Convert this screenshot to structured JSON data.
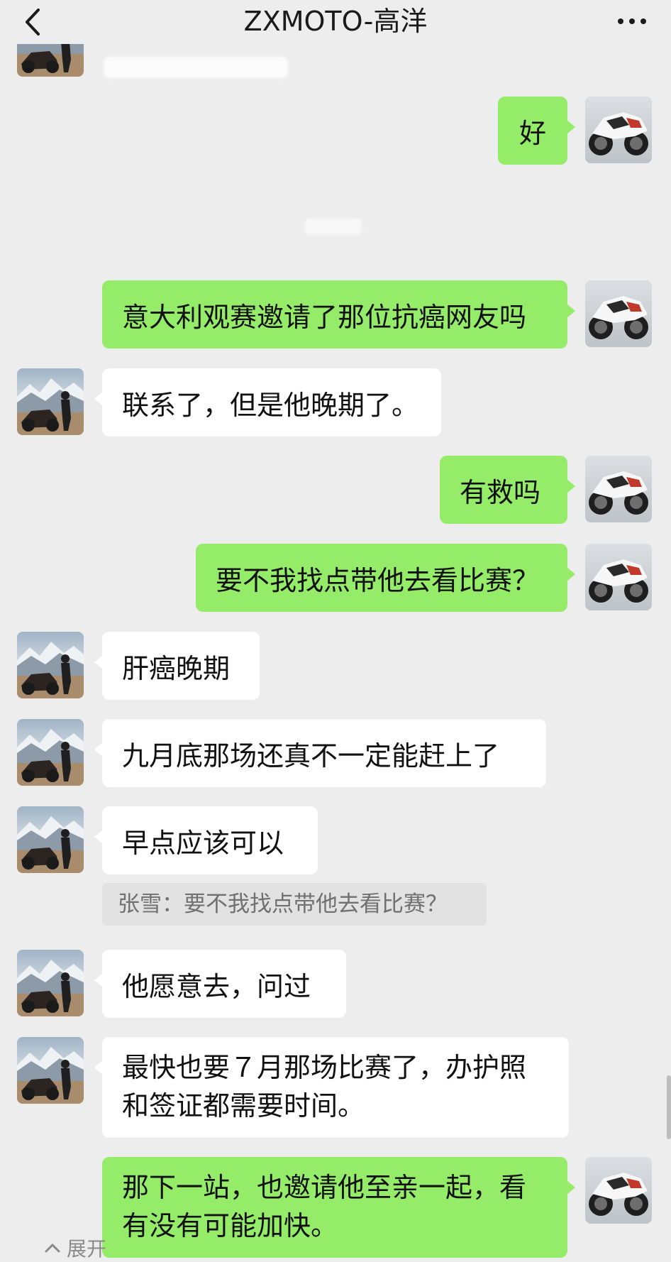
{
  "header": {
    "title": "ZXMOTO-高洋",
    "back_icon": "chevron-left-icon",
    "more_icon": "more-dots-icon"
  },
  "messages": [
    {
      "side": "self",
      "text": "好"
    },
    {
      "side": "self",
      "text": "意大利观赛邀请了那位抗癌网友吗"
    },
    {
      "side": "peer",
      "text": "联系了，但是他晚期了。"
    },
    {
      "side": "self",
      "text": "有救吗"
    },
    {
      "side": "self",
      "text": "要不我找点带他去看比赛？"
    },
    {
      "side": "peer",
      "text": "肝癌晚期"
    },
    {
      "side": "peer",
      "text": "九月底那场还真不一定能赶上了"
    },
    {
      "side": "peer",
      "text": "早点应该可以"
    },
    {
      "side": "peer",
      "text": "他愿意去，问过"
    },
    {
      "side": "peer",
      "lines": [
        "最快也要７月那场比赛了，办护照",
        "和签证都需要时间。"
      ]
    },
    {
      "side": "self",
      "lines": [
        "那下一站，也邀请他至亲一起，看",
        "有没有可能加快。"
      ]
    }
  ],
  "quote": {
    "text": "张雪：要不我找点带他去看比赛？"
  },
  "footer": {
    "expand_label": "展开",
    "expand_icon": "chevron-up-icon"
  },
  "colors": {
    "background": "#ededed",
    "self_bubble": "#95ec69",
    "peer_bubble": "#ffffff",
    "quote_bg": "#e2e2e2"
  }
}
